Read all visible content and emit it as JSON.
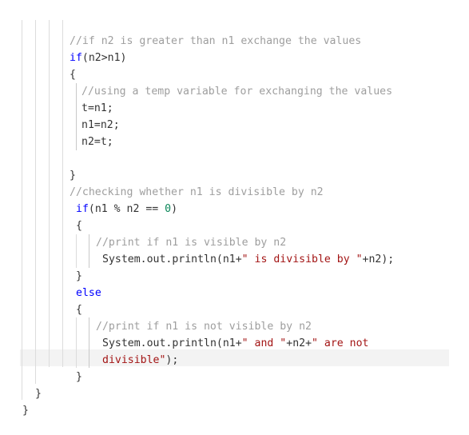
{
  "editor": {
    "colors": {
      "keyword": "#0000ff",
      "number": "#098658",
      "string": "#a31515",
      "comment": "#9e9e9e",
      "plain": "#333333",
      "highlight": "#f3f3f3"
    },
    "lines": [
      {
        "tokens": []
      },
      {
        "tokens": [
          {
            "t": "cm",
            "v": "//if n2 is greater than n1 exchange the values"
          }
        ]
      },
      {
        "tokens": [
          {
            "t": "kw",
            "v": "if"
          },
          {
            "t": "pl",
            "v": "(n2>n1)"
          }
        ]
      },
      {
        "tokens": [
          {
            "t": "pl",
            "v": "{"
          }
        ]
      },
      {
        "tokens": [
          {
            "t": "cm",
            "v": "//using a temp variable for exchanging the values"
          }
        ]
      },
      {
        "tokens": [
          {
            "t": "pl",
            "v": "t=n1;"
          }
        ]
      },
      {
        "tokens": [
          {
            "t": "pl",
            "v": "n1=n2;"
          }
        ]
      },
      {
        "tokens": [
          {
            "t": "pl",
            "v": "n2=t;"
          }
        ]
      },
      {
        "tokens": []
      },
      {
        "tokens": [
          {
            "t": "pl",
            "v": "}"
          }
        ]
      },
      {
        "tokens": [
          {
            "t": "cm",
            "v": "//checking whether n1 is divisible by n2"
          }
        ]
      },
      {
        "tokens": [
          {
            "t": "kw",
            "v": "if"
          },
          {
            "t": "pl",
            "v": "(n1 % n2 == "
          },
          {
            "t": "num",
            "v": "0"
          },
          {
            "t": "pl",
            "v": ")"
          }
        ]
      },
      {
        "tokens": [
          {
            "t": "pl",
            "v": "{"
          }
        ]
      },
      {
        "tokens": [
          {
            "t": "cm",
            "v": "//print if n1 is visible by n2"
          }
        ]
      },
      {
        "tokens": [
          {
            "t": "pl",
            "v": "System.out.println(n1+"
          },
          {
            "t": "str",
            "v": "\" is divisible by \""
          },
          {
            "t": "pl",
            "v": "+n2);"
          }
        ]
      },
      {
        "tokens": [
          {
            "t": "pl",
            "v": "}"
          }
        ]
      },
      {
        "tokens": [
          {
            "t": "kw",
            "v": "else"
          }
        ]
      },
      {
        "tokens": [
          {
            "t": "pl",
            "v": "{"
          }
        ]
      },
      {
        "tokens": [
          {
            "t": "cm",
            "v": "//print if n1 is not visible by n2"
          }
        ]
      },
      {
        "tokens": [
          {
            "t": "pl",
            "v": "System.out.println(n1+"
          },
          {
            "t": "str",
            "v": "\" and \""
          },
          {
            "t": "pl",
            "v": "+n2+"
          },
          {
            "t": "str",
            "v": "\" are not"
          }
        ]
      },
      {
        "tokens": [
          {
            "t": "str",
            "v": "divisible\""
          },
          {
            "t": "pl",
            "v": ");"
          }
        ]
      },
      {
        "tokens": [
          {
            "t": "pl",
            "v": "}"
          }
        ]
      },
      {
        "tokens": [
          {
            "t": "pl",
            "v": "}"
          }
        ]
      },
      {
        "tokens": [
          {
            "t": "pl",
            "v": "}"
          }
        ]
      }
    ]
  }
}
